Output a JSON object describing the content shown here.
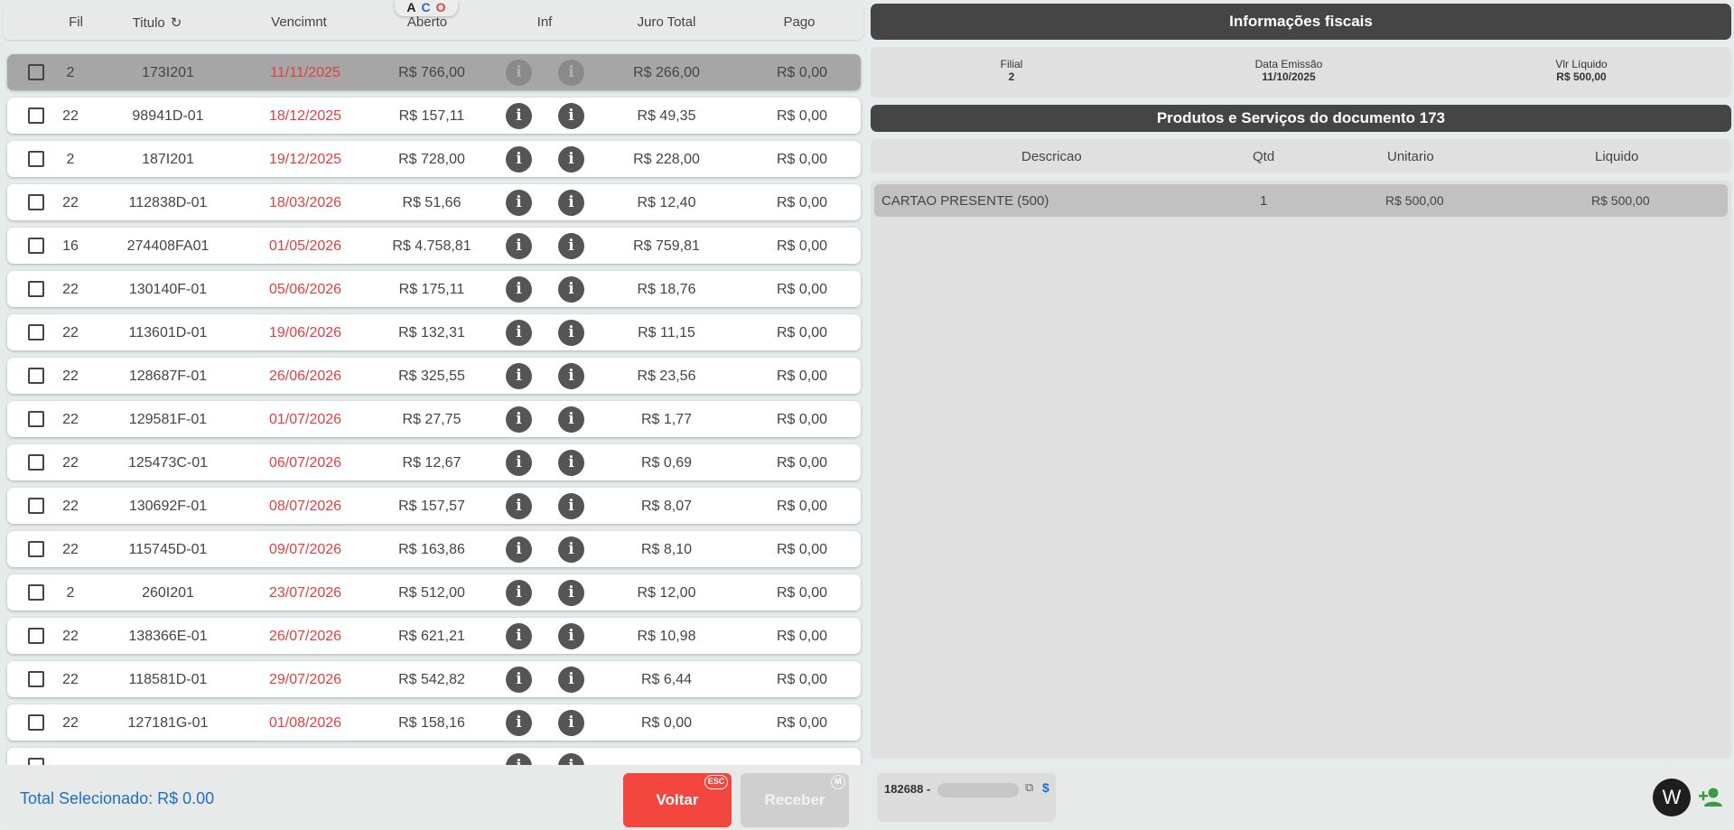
{
  "table": {
    "headers": {
      "fil": "Fil",
      "titulo": "Titulo",
      "vencimento": "Vencimnt",
      "aberto": "Aberto",
      "inf": "Inf",
      "juro": "Juro Total",
      "pago": "Pago"
    },
    "aco": {
      "a": "A",
      "c": "C",
      "o": "O"
    },
    "rows": [
      {
        "fil": "2",
        "titulo": "173I201",
        "venc": "11/11/2025",
        "aberto": "R$ 766,00",
        "juro": "R$ 266,00",
        "pago": "R$ 0,00"
      },
      {
        "fil": "22",
        "titulo": "98941D-01",
        "venc": "18/12/2025",
        "aberto": "R$ 157,11",
        "juro": "R$ 49,35",
        "pago": "R$ 0,00"
      },
      {
        "fil": "2",
        "titulo": "187I201",
        "venc": "19/12/2025",
        "aberto": "R$ 728,00",
        "juro": "R$ 228,00",
        "pago": "R$ 0,00"
      },
      {
        "fil": "22",
        "titulo": "112838D-01",
        "venc": "18/03/2026",
        "aberto": "R$ 51,66",
        "juro": "R$ 12,40",
        "pago": "R$ 0,00"
      },
      {
        "fil": "16",
        "titulo": "274408FA01",
        "venc": "01/05/2026",
        "aberto": "R$ 4.758,81",
        "juro": "R$ 759,81",
        "pago": "R$ 0,00"
      },
      {
        "fil": "22",
        "titulo": "130140F-01",
        "venc": "05/06/2026",
        "aberto": "R$ 175,11",
        "juro": "R$ 18,76",
        "pago": "R$ 0,00"
      },
      {
        "fil": "22",
        "titulo": "113601D-01",
        "venc": "19/06/2026",
        "aberto": "R$ 132,31",
        "juro": "R$ 11,15",
        "pago": "R$ 0,00"
      },
      {
        "fil": "22",
        "titulo": "128687F-01",
        "venc": "26/06/2026",
        "aberto": "R$ 325,55",
        "juro": "R$ 23,56",
        "pago": "R$ 0,00"
      },
      {
        "fil": "22",
        "titulo": "129581F-01",
        "venc": "01/07/2026",
        "aberto": "R$ 27,75",
        "juro": "R$ 1,77",
        "pago": "R$ 0,00"
      },
      {
        "fil": "22",
        "titulo": "125473C-01",
        "venc": "06/07/2026",
        "aberto": "R$ 12,67",
        "juro": "R$ 0,69",
        "pago": "R$ 0,00"
      },
      {
        "fil": "22",
        "titulo": "130692F-01",
        "venc": "08/07/2026",
        "aberto": "R$ 157,57",
        "juro": "R$ 8,07",
        "pago": "R$ 0,00"
      },
      {
        "fil": "22",
        "titulo": "115745D-01",
        "venc": "09/07/2026",
        "aberto": "R$ 163,86",
        "juro": "R$ 8,10",
        "pago": "R$ 0,00"
      },
      {
        "fil": "2",
        "titulo": "260I201",
        "venc": "23/07/2026",
        "aberto": "R$ 512,00",
        "juro": "R$ 12,00",
        "pago": "R$ 0,00"
      },
      {
        "fil": "22",
        "titulo": "138366E-01",
        "venc": "26/07/2026",
        "aberto": "R$ 621,21",
        "juro": "R$ 10,98",
        "pago": "R$ 0,00"
      },
      {
        "fil": "22",
        "titulo": "118581D-01",
        "venc": "29/07/2026",
        "aberto": "R$ 542,82",
        "juro": "R$ 6,44",
        "pago": "R$ 0,00"
      },
      {
        "fil": "22",
        "titulo": "127181G-01",
        "venc": "01/08/2026",
        "aberto": "R$ 158,16",
        "juro": "R$ 0,00",
        "pago": "R$ 0,00"
      }
    ]
  },
  "footer_left": {
    "total": "Total Selecionado: R$ 0.00",
    "voltar": "Voltar",
    "voltar_key": "ESC",
    "receber": "Receber",
    "receber_key": "M"
  },
  "fiscal": {
    "title": "Informações fiscais",
    "filial_label": "Filial",
    "filial_value": "2",
    "emissao_label": "Data Emissão",
    "emissao_value": "11/10/2025",
    "liquido_label": "Vlr Líquido",
    "liquido_value": "R$ 500,00"
  },
  "produtos": {
    "title": "Produtos e Serviços do documento 173",
    "headers": {
      "descricao": "Descricao",
      "qtd": "Qtd",
      "unitario": "Unitario",
      "liquido": "Liquido"
    },
    "rows": [
      {
        "descricao": "CARTAO PRESENTE (500)",
        "qtd": "1",
        "unitario": "R$ 500,00",
        "liquido": "R$ 500,00"
      }
    ]
  },
  "footer_right": {
    "client_id": "182688 -",
    "w_label": "W"
  },
  "colors": {
    "accent": "#f2463e",
    "date": "#e0413e",
    "total": "#1e6fc7",
    "dark_bar": "#454545"
  }
}
